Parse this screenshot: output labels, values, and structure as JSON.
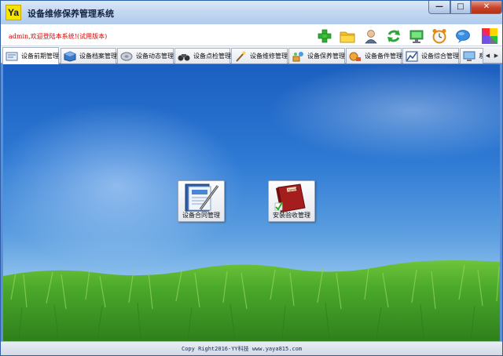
{
  "window": {
    "logo_text": "Ya",
    "title": "设备维修保养管理系统",
    "minimize_glyph": "—",
    "maximize_glyph": "□",
    "close_glyph": "✕"
  },
  "header": {
    "welcome": "admin,欢迎登陆本系统!(试用版本)",
    "toolbar_icons": [
      "add-icon",
      "folder-icon",
      "user-icon",
      "refresh-icon",
      "monitor-icon",
      "alarm-clock-icon",
      "chat-icon",
      "color-palette-icon"
    ]
  },
  "tabs": [
    {
      "label": "设备前期管理",
      "icon": "device-list-icon",
      "active": true
    },
    {
      "label": "设备档案管理",
      "icon": "cube-icon"
    },
    {
      "label": "设备动态管理",
      "icon": "disc-icon"
    },
    {
      "label": "设备点检管理",
      "icon": "binoculars-icon"
    },
    {
      "label": "设备维修管理",
      "icon": "wand-icon"
    },
    {
      "label": "设备保养管理",
      "icon": "tools-icon"
    },
    {
      "label": "设备备件管理",
      "icon": "parts-icon"
    },
    {
      "label": "设备综合管理",
      "icon": "chart-icon"
    },
    {
      "label": "系统",
      "icon": "computer-icon"
    }
  ],
  "tab_scroll": {
    "left": "◀",
    "right": "▶"
  },
  "modules": [
    {
      "label": "设备合同管理",
      "icon": "contract-pen-icon"
    },
    {
      "label": "安装验收管理",
      "icon": "acceptance-book-icon",
      "book_text": "Agenda"
    }
  ],
  "footer": {
    "copyright": "Copy Right2016-YY科技  www.yaya815.com"
  },
  "colors": {
    "welcome_text": "#d40000",
    "sky_top": "#1b5fc0",
    "grass": "#4aa82a"
  }
}
